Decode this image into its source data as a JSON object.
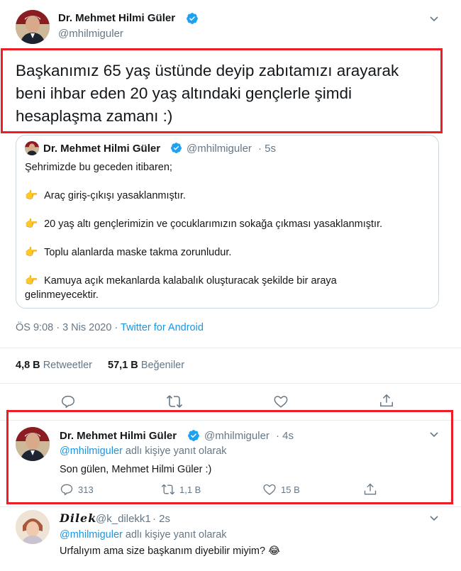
{
  "main_tweet": {
    "author_name": "Dr. Mehmet Hilmi Güler",
    "author_handle": "@mhilmiguler",
    "text_line1": "Başkanımız 65 yaş üstünde deyip zabıtamızı arayarak",
    "text_line2": "beni ihbar eden 20 yaş altındaki gençlerle şimdi",
    "text_line3": "hesaplaşma zamanı :)",
    "timestamp": "ÖS 9:08 · 3 Nis 2020 · ",
    "source": "Twitter for Android",
    "retweets_count": "4,8 B",
    "retweets_label": "Retweetler",
    "likes_count": "57,1 B",
    "likes_label": "Beğeniler"
  },
  "quoted_tweet": {
    "author_name": "Dr. Mehmet Hilmi Güler",
    "author_handle": "@mhilmiguler",
    "time": "· 5s",
    "intro": "Şehrimizde bu geceden itibaren;",
    "items": [
      "Araç giriş-çıkışı yasaklanmıştır.",
      "20 yaş altı gençlerimizin ve çocuklarımızın sokağa çıkması yasaklanmıştır.",
      "Toplu alanlarda maske takma zorunludur.",
      "Kamuya açık mekanlarda kalabalık oluşturacak şekilde bir araya",
      "gelinmeyecektir."
    ],
    "pointer_emoji": "👉"
  },
  "reply_1": {
    "author_name": "Dr. Mehmet Hilmi Güler",
    "author_handle": "@mhilmiguler",
    "time": "· 4s",
    "reply_to_handle": "@mhilmiguler",
    "reply_to_suffix": " adlı kişiye yanıt olarak",
    "text": "Son gülen, Mehmet Hilmi Güler :)",
    "replies": "313",
    "retweets": "1,1 B",
    "likes": "15 B"
  },
  "reply_2": {
    "author_name": "Dilek",
    "author_handle": "@k_dilekk1",
    "time": "· 2s",
    "reply_to_handle": "@mhilmiguler",
    "reply_to_suffix": " adlı kişiye yanıt olarak",
    "text": "Urfalıyım ama size başkanım diyebilir miyim? 😂"
  },
  "colors": {
    "highlight_border": "#ee1c25",
    "verified": "#1da1f2",
    "link": "#1b95e0",
    "muted": "#657786"
  }
}
